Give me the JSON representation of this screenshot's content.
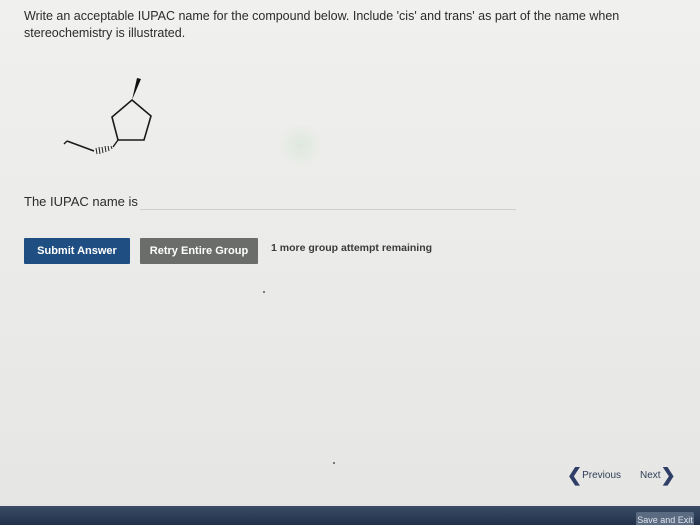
{
  "question": {
    "text": "Write an acceptable IUPAC name for the compound below. Include 'cis' and trans' as part of the name when stereochemistry is illustrated."
  },
  "molecule": {
    "ring": "cyclopentane",
    "substituents": [
      {
        "name": "methyl",
        "bond": "wedge"
      },
      {
        "name": "ethyl",
        "bond": "hashed-wedge"
      }
    ]
  },
  "answer": {
    "label": "The IUPAC name is",
    "value": "",
    "placeholder": ""
  },
  "buttons": {
    "submit_label": "Submit Answer",
    "retry_label": "Retry Entire Group"
  },
  "attempts_text": "1 more group attempt remaining",
  "nav": {
    "previous_label": "Previous",
    "next_label": "Next"
  },
  "footer": {
    "save_exit_label": "Save and Exit"
  },
  "colors": {
    "submit": "#1f4f82",
    "retry": "#6b6d6b",
    "footer_bar": "#22314a",
    "nav_arrow": "#2e3e66"
  }
}
